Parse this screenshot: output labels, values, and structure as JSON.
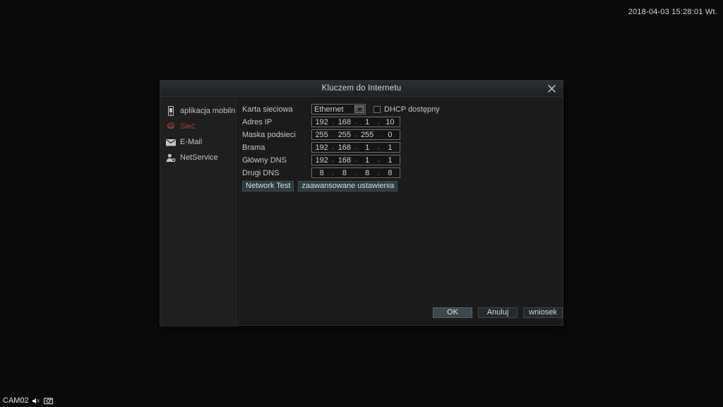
{
  "osd": {
    "timestamp": "2018-04-03 15:28:01 Wt.",
    "channel_label": "CAM02",
    "speaker_icon": "speaker-mute-icon",
    "snapshot_icon": "snapshot-camera-icon"
  },
  "dialog": {
    "title": "Kluczem do Internetu",
    "close_label": "✕"
  },
  "sidebar": {
    "items": [
      {
        "label": "aplikacja mobiln",
        "icon": "mobile-phone-icon",
        "active": false
      },
      {
        "label": "Sieć",
        "icon": "gear-icon",
        "active": true
      },
      {
        "label": "E-Mail",
        "icon": "envelope-icon",
        "active": false
      },
      {
        "label": "NetService",
        "icon": "user-settings-icon",
        "active": false
      }
    ]
  },
  "form": {
    "adapter": {
      "label": "Karta sieciowa",
      "value": "Ethernet",
      "arrow_icon": "chevron-down-icon"
    },
    "dhcp": {
      "label": "DHCP dostępny",
      "checked": false
    },
    "fields": [
      {
        "label": "Adres IP",
        "octets": [
          "192",
          "168",
          "1",
          "10"
        ]
      },
      {
        "label": "Maska podsieci",
        "octets": [
          "255",
          "255",
          "255",
          "0"
        ]
      },
      {
        "label": "Brama",
        "octets": [
          "192",
          "168",
          "1",
          "1"
        ]
      },
      {
        "label": "Główny DNS",
        "octets": [
          "192",
          "168",
          "1",
          "1"
        ]
      },
      {
        "label": "Drugi DNS",
        "octets": [
          "8",
          "8",
          "8",
          "8"
        ]
      }
    ],
    "separator": ".",
    "actions": [
      {
        "label": "Network Test"
      },
      {
        "label": "zaawansowane ustawienia"
      }
    ]
  },
  "footer": {
    "buttons": [
      {
        "label": "OK",
        "focused": true
      },
      {
        "label": "Anuluj",
        "focused": false
      },
      {
        "label": "wniosek",
        "focused": false
      }
    ]
  },
  "colors": {
    "accent_active": "#b03a3a",
    "action_bg": "#2c3a3e",
    "focus_bg": "#3a474c",
    "dialog_bg": "#1b1b1b",
    "sidebar_bg": "#1e1f1e"
  }
}
